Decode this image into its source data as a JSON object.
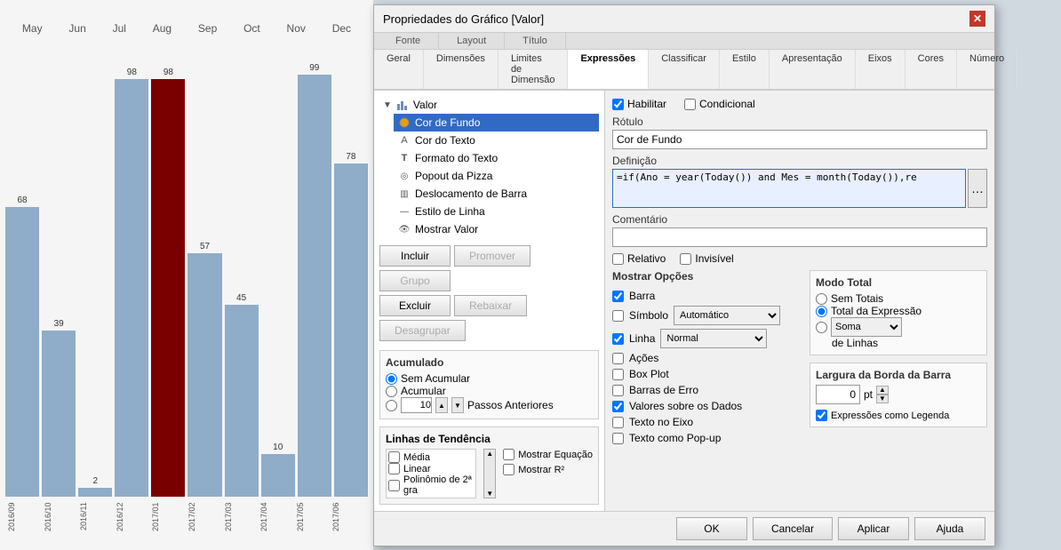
{
  "chart": {
    "months": [
      "May",
      "Jun",
      "Jul",
      "Aug",
      "Sep",
      "Oct",
      "Nov",
      "Dec"
    ],
    "bars": [
      {
        "label": "68",
        "value": 68,
        "xLabel": "2016/09",
        "dark": false
      },
      {
        "label": "39",
        "value": 39,
        "xLabel": "2016/10",
        "dark": false
      },
      {
        "label": "2",
        "value": 2,
        "xLabel": "2016/11",
        "dark": false
      },
      {
        "label": "98",
        "value": 98,
        "xLabel": "2016/12",
        "dark": false
      },
      {
        "label": "98",
        "value": 98,
        "xLabel": "2017/01",
        "dark": true
      },
      {
        "label": "57",
        "value": 57,
        "xLabel": "2017/02",
        "dark": false
      },
      {
        "label": "45",
        "value": 45,
        "xLabel": "2017/03",
        "dark": false
      },
      {
        "label": "10",
        "value": 10,
        "xLabel": "2017/04",
        "dark": false
      },
      {
        "label": "99",
        "value": 99,
        "xLabel": "2017/05",
        "dark": false
      },
      {
        "label": "78",
        "value": 78,
        "xLabel": "2017/06",
        "dark": false
      }
    ]
  },
  "dialog": {
    "title": "Propriedades do Gráfico [Valor]",
    "close": "✕",
    "tabGroups": [
      {
        "label": "Fonte"
      },
      {
        "label": "Layout"
      },
      {
        "label": "Título"
      }
    ],
    "tabs": [
      {
        "label": "Geral",
        "active": false
      },
      {
        "label": "Dimensões",
        "active": false
      },
      {
        "label": "Limites de Dimensão",
        "active": false
      },
      {
        "label": "Expressões",
        "active": true
      },
      {
        "label": "Classificar",
        "active": false
      },
      {
        "label": "Estilo",
        "active": false
      },
      {
        "label": "Apresentação",
        "active": false
      },
      {
        "label": "Eixos",
        "active": false
      },
      {
        "label": "Cores",
        "active": false
      },
      {
        "label": "Número",
        "active": false
      }
    ],
    "tree": {
      "root": "Valor",
      "children": [
        {
          "label": "Cor de Fundo",
          "selected": true,
          "icon": "color"
        },
        {
          "label": "Cor do Texto",
          "icon": "text"
        },
        {
          "label": "Formato do Texto",
          "icon": "format"
        },
        {
          "label": "Popout da Pizza",
          "icon": "popup"
        },
        {
          "label": "Deslocamento de Barra",
          "icon": "bar"
        },
        {
          "label": "Estilo de Linha",
          "icon": "line"
        },
        {
          "label": "Mostrar Valor",
          "icon": "show"
        }
      ]
    },
    "buttons": {
      "incluir": "Incluir",
      "promover": "Promover",
      "grupo": "Grupo",
      "excluir": "Excluir",
      "rebaixar": "Rebaixar",
      "desagrupar": "Desagrupar"
    },
    "acumulado": {
      "title": "Acumulado",
      "options": [
        "Sem Acumular",
        "Acumular",
        "Acumular"
      ],
      "passosLabel": "Passos Anteriores",
      "passosValue": "10"
    },
    "linhas": {
      "title": "Linhas de Tendência",
      "items": [
        "Média",
        "Linear",
        "Polinômio de 2ª gra"
      ],
      "mostrarEquacao": "Mostrar Equação",
      "mostrarR2": "Mostrar R²"
    },
    "right": {
      "habilitar": "Habilitar",
      "condicional": "Condicional",
      "rotulo": "Rótulo",
      "rotuloValue": "Cor de Fundo",
      "definicao": "Definição",
      "definicaoValue": "=if(Ano = year(Today()) and Mes = month(Today()),re",
      "comentario": "Comentário",
      "comentarioValue": "",
      "relativo": "Relativo",
      "invisivel": "Invisível",
      "mostrarOpcoes": {
        "title": "Mostrar Opções",
        "barra": "Barra",
        "simbolo": "Símbolo",
        "simboloValue": "Automático",
        "linha": "Linha",
        "linhaValue": "Normal",
        "acoes": "Ações",
        "boxPlot": "Box Plot",
        "barrasErro": "Barras de Erro",
        "valoresDados": "Valores sobre os Dados",
        "textoEixo": "Texto no Eixo",
        "textoPopup": "Texto como Pop-up"
      },
      "modoTotal": {
        "title": "Modo Total",
        "semTotais": "Sem Totais",
        "totalExpressao": "Total da Expressão",
        "soma": "Soma",
        "deLinhas": "de Linhas",
        "somaValue": "Soma"
      },
      "largura": {
        "title": "Largura da Borda da Barra",
        "value": "0",
        "unit": "pt"
      },
      "expressoesLegenda": "Expressões como Legenda"
    },
    "bottomButtons": {
      "ok": "OK",
      "cancelar": "Cancelar",
      "aplicar": "Aplicar",
      "ajuda": "Ajuda"
    }
  }
}
